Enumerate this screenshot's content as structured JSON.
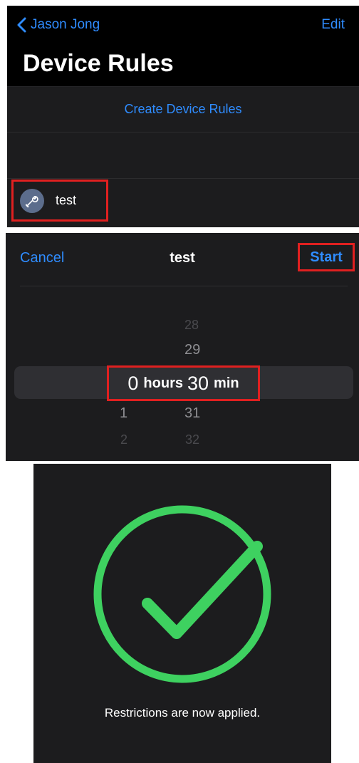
{
  "rules_screen": {
    "back_label": "Jason Jong",
    "edit_label": "Edit",
    "title": "Device Rules",
    "create_label": "Create Device Rules",
    "rule_item": {
      "label": "test",
      "icon": "wrench-icon"
    }
  },
  "timer_screen": {
    "cancel_label": "Cancel",
    "title": "test",
    "start_label": "Start",
    "picker": {
      "hours_above": [],
      "hours_selected": "0",
      "hours_below": [
        "1",
        "2"
      ],
      "hours_unit": "hours",
      "minutes_above": [
        "28",
        "29"
      ],
      "minutes_selected": "30",
      "minutes_below": [
        "31",
        "32"
      ],
      "minutes_unit": "min"
    }
  },
  "confirmation_screen": {
    "icon": "checkmark-circle-icon",
    "message": "Restrictions are now applied.",
    "accent_color": "#3ed160"
  },
  "colors": {
    "link_blue": "#2f8cff",
    "highlight_red": "#e02020",
    "surface": "#1c1c1e"
  }
}
